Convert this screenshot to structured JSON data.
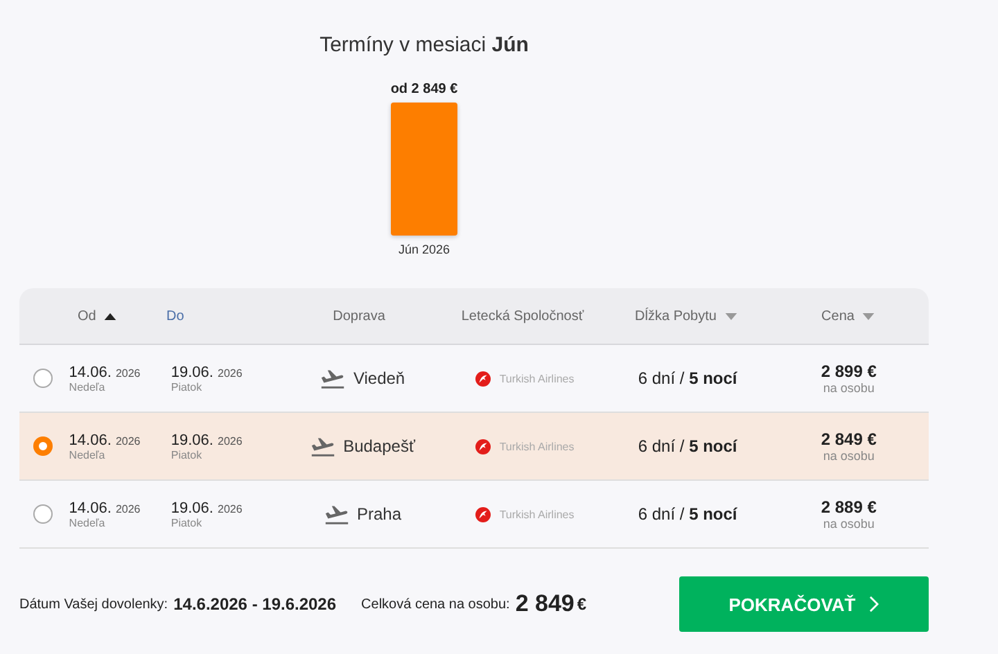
{
  "chart": {
    "title": "Termíny v mesiaci **Jún**",
    "bars": [
      {
        "value_label": "od 2 849 €",
        "label": "Jún 2026",
        "selected": true
      }
    ]
  },
  "table": {
    "columns": [
      {
        "label": "Od",
        "sort_up": true,
        "sort_down": false,
        "highlighted": false
      },
      {
        "label": "Do",
        "sort_up": false,
        "sort_down": false,
        "highlighted": true
      },
      {
        "label": "Doprava",
        "sort_up": false,
        "sort_down": false,
        "highlighted": false
      },
      {
        "label": "Letecká Spoločnosť",
        "sort_up": false,
        "sort_down": false,
        "highlighted": false
      },
      {
        "label": "Dĺžka Pobytu",
        "sort_up": false,
        "sort_down": true,
        "highlighted": false
      },
      {
        "label": "Cena",
        "sort_up": false,
        "sort_down": true,
        "highlighted": false
      }
    ],
    "rows": [
      {
        "selected": false,
        "from_date": "14.06.",
        "from_year": "2026",
        "from_day": "Nedeľa",
        "to_date": "19.06.",
        "to_year": "2026",
        "to_day": "Piatok",
        "transport": "Viedeň",
        "airline": "Turkish Airlines",
        "duration": "6 dní / **5 nocí**",
        "price": "2 899 €",
        "price_note": "na osobu"
      },
      {
        "selected": true,
        "from_date": "14.06.",
        "from_year": "2026",
        "from_day": "Nedeľa",
        "to_date": "19.06.",
        "to_year": "2026",
        "to_day": "Piatok",
        "transport": "Budapešť",
        "airline": "Turkish Airlines",
        "duration": "6 dní / **5 nocí**",
        "price": "2 849 €",
        "price_note": "na osobu"
      },
      {
        "selected": false,
        "from_date": "14.06.",
        "from_year": "2026",
        "from_day": "Nedeľa",
        "to_date": "19.06.",
        "to_year": "2026",
        "to_day": "Piatok",
        "transport": "Praha",
        "airline": "Turkish Airlines",
        "duration": "6 dní / **5 nocí**",
        "price": "2 889 €",
        "price_note": "na osobu"
      }
    ]
  },
  "footer": {
    "date_label": "Dátum Vašej dovolenky:",
    "date_value": "14.6.2026 - 19.6.2026",
    "price_label": "Celková cena na osobu:",
    "price_value": "2 849",
    "currency": "€",
    "button": "POKRAČOVAŤ"
  }
}
